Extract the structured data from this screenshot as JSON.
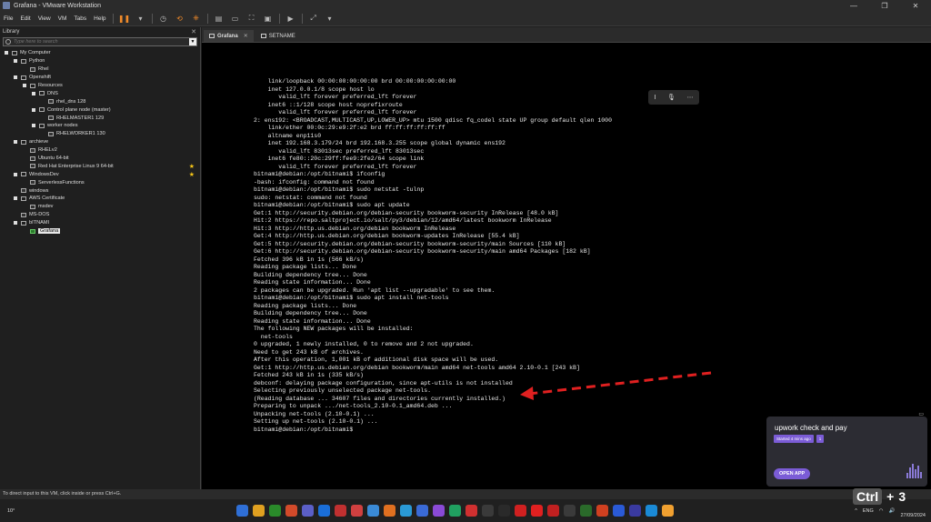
{
  "window": {
    "title": "Grafana - VMware Workstation"
  },
  "menu": [
    "File",
    "Edit",
    "View",
    "VM",
    "Tabs",
    "Help"
  ],
  "library": {
    "title": "Library",
    "search_placeholder": "Type here to search",
    "items": [
      {
        "label": "My Computer",
        "level": 0,
        "kind": "computer",
        "expandable": true
      },
      {
        "label": "Python",
        "level": 1,
        "kind": "folder",
        "expandable": true
      },
      {
        "label": "Rhel",
        "level": 2,
        "kind": "vm"
      },
      {
        "label": "Openshift",
        "level": 1,
        "kind": "folder",
        "expandable": true
      },
      {
        "label": "Resources",
        "level": 2,
        "kind": "folder",
        "expandable": true
      },
      {
        "label": "DNS",
        "level": 3,
        "kind": "folder",
        "expandable": true
      },
      {
        "label": "rhel_dns 128",
        "level": 4,
        "kind": "vm"
      },
      {
        "label": "Control plane node (master)",
        "level": 3,
        "kind": "folder",
        "expandable": true
      },
      {
        "label": "RHELMASTER1 129",
        "level": 4,
        "kind": "vm"
      },
      {
        "label": "worker nodes",
        "level": 3,
        "kind": "folder",
        "expandable": true
      },
      {
        "label": "RHELWORKER1 130",
        "level": 4,
        "kind": "vm"
      },
      {
        "label": "archieve",
        "level": 1,
        "kind": "folder",
        "expandable": true
      },
      {
        "label": "RHELv2",
        "level": 2,
        "kind": "vm"
      },
      {
        "label": "Ubuntu 64-bit",
        "level": 2,
        "kind": "vm"
      },
      {
        "label": "Red Hat Enterprise Linux 9 64-bit",
        "level": 2,
        "kind": "vm",
        "starred": true
      },
      {
        "label": "WindowsDev",
        "level": 1,
        "kind": "folder",
        "expandable": true,
        "starred": true
      },
      {
        "label": "ServerlessFunctions",
        "level": 2,
        "kind": "vm"
      },
      {
        "label": "windows",
        "level": 1,
        "kind": "vm"
      },
      {
        "label": "AWS Certificate",
        "level": 1,
        "kind": "folder",
        "expandable": true
      },
      {
        "label": "msdev",
        "level": 2,
        "kind": "vm"
      },
      {
        "label": "MS-DOS",
        "level": 1,
        "kind": "vm"
      },
      {
        "label": "bITNAMI",
        "level": 1,
        "kind": "folder",
        "expandable": true
      },
      {
        "label": "Grafana",
        "level": 2,
        "kind": "vm",
        "running": true,
        "selected": true
      }
    ]
  },
  "tabs": [
    {
      "label": "Grafana",
      "active": true
    },
    {
      "label": "SETNAME",
      "active": false
    }
  ],
  "console": {
    "lines": [
      "    link/loopback 00:00:00:00:00:00 brd 00:00:00:00:00:00",
      "    inet 127.0.0.1/8 scope host lo",
      "       valid_lft forever preferred_lft forever",
      "    inet6 ::1/128 scope host noprefixroute",
      "       valid_lft forever preferred_lft forever",
      "2: ens192: <BROADCAST,MULTICAST,UP,LOWER_UP> mtu 1500 qdisc fq_codel state UP group default qlen 1000",
      "    link/ether 00:0c:29:e9:2f:e2 brd ff:ff:ff:ff:ff:ff",
      "    altname enp11s0",
      "    inet 192.168.3.179/24 brd 192.168.3.255 scope global dynamic ens192",
      "       valid_lft 83013sec preferred_lft 83013sec",
      "    inet6 fe80::20c:29ff:fee9:2fe2/64 scope link",
      "       valid_lft forever preferred_lft forever",
      "bitnami@debian:/opt/bitnami$ ifconfig",
      "-bash: ifconfig: command not found",
      "bitnami@debian:/opt/bitnami$ sudo netstat -tulnp",
      "sudo: netstat: command not found",
      "bitnami@debian:/opt/bitnami$ sudo apt update",
      "Get:1 http://security.debian.org/debian-security bookworm-security InRelease [48.0 kB]",
      "Hit:2 https://repo.saltproject.io/salt/py3/debian/12/amd64/latest bookworm InRelease",
      "Hit:3 http://http.us.debian.org/debian bookworm InRelease",
      "Get:4 http://http.us.debian.org/debian bookworm-updates InRelease [55.4 kB]",
      "Get:5 http://security.debian.org/debian-security bookworm-security/main Sources [110 kB]",
      "Get:6 http://security.debian.org/debian-security bookworm-security/main amd64 Packages [182 kB]",
      "Fetched 396 kB in 1s (566 kB/s)",
      "Reading package lists... Done",
      "Building dependency tree... Done",
      "Reading state information... Done",
      "2 packages can be upgraded. Run 'apt list --upgradable' to see them.",
      "bitnami@debian:/opt/bitnami$ sudo apt install net-tools",
      "Reading package lists... Done",
      "Building dependency tree... Done",
      "Reading state information... Done",
      "The following NEW packages will be installed:",
      "  net-tools",
      "0 upgraded, 1 newly installed, 0 to remove and 2 not upgraded.",
      "Need to get 243 kB of archives.",
      "After this operation, 1,001 kB of additional disk space will be used.",
      "Get:1 http://http.us.debian.org/debian bookworm/main amd64 net-tools amd64 2.10-0.1 [243 kB]",
      "Fetched 243 kB in 1s (335 kB/s)",
      "debconf: delaying package configuration, since apt-utils is not installed",
      "Selecting previously unselected package net-tools.",
      "(Reading database ... 34607 files and directories currently installed.)",
      "Preparing to unpack .../net-tools_2.10-0.1_amd64.deb ...",
      "Unpacking net-tools (2.10-0.1) ...",
      "Setting up net-tools (2.10-0.1) ...",
      "bitnami@debian:/opt/bitnami$"
    ]
  },
  "notification": {
    "title": "upwork check and pay",
    "time": "Started 4 mins ago",
    "count": "1",
    "action": "OPEN APP"
  },
  "statusbar": {
    "text": "To direct input to this VM, click inside or press Ctrl+G."
  },
  "taskbar": {
    "temperature": "10°",
    "language": "ENG",
    "date": "27/09/2024",
    "icon_colors": [
      "#2f6fd6",
      "#e0a020",
      "#2a8a2a",
      "#d24a2a",
      "#5b5fc7",
      "#1a6ed8",
      "#c03030",
      "#d04040",
      "#3a8ad6",
      "#e07020",
      "#2a9ad6",
      "#3a6ad6",
      "#8a4ad6",
      "#20a060",
      "#d03030",
      "#3a3a3a",
      "#2a2a2a",
      "#d02020",
      "#e02020",
      "#c02020",
      "#3a3a3a",
      "#2a6a2a",
      "#d04020",
      "#2a5ad6",
      "#3a3aa0",
      "#1a8ad6",
      "#f0a030"
    ]
  },
  "overlay": {
    "key": "Ctrl",
    "plus": "+",
    "digit": "3"
  },
  "colors": {
    "accent": "#f08a2a",
    "notification_accent": "#7b5cd6",
    "arrow": "#e02020"
  }
}
